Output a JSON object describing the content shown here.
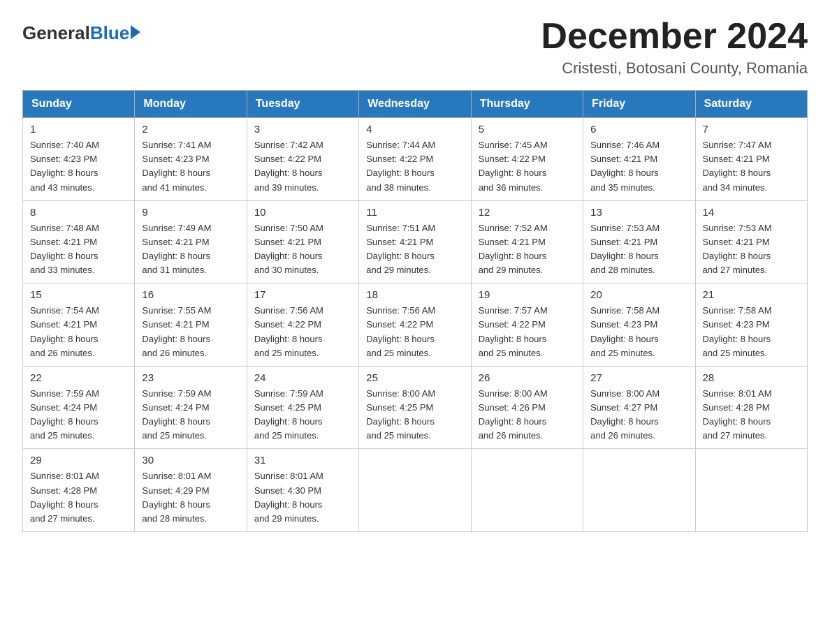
{
  "logo": {
    "general": "General",
    "blue": "Blue"
  },
  "title": "December 2024",
  "subtitle": "Cristesti, Botosani County, Romania",
  "weekdays": [
    "Sunday",
    "Monday",
    "Tuesday",
    "Wednesday",
    "Thursday",
    "Friday",
    "Saturday"
  ],
  "weeks": [
    [
      {
        "day": "1",
        "sunrise": "7:40 AM",
        "sunset": "4:23 PM",
        "daylight": "8 hours and 43 minutes."
      },
      {
        "day": "2",
        "sunrise": "7:41 AM",
        "sunset": "4:23 PM",
        "daylight": "8 hours and 41 minutes."
      },
      {
        "day": "3",
        "sunrise": "7:42 AM",
        "sunset": "4:22 PM",
        "daylight": "8 hours and 39 minutes."
      },
      {
        "day": "4",
        "sunrise": "7:44 AM",
        "sunset": "4:22 PM",
        "daylight": "8 hours and 38 minutes."
      },
      {
        "day": "5",
        "sunrise": "7:45 AM",
        "sunset": "4:22 PM",
        "daylight": "8 hours and 36 minutes."
      },
      {
        "day": "6",
        "sunrise": "7:46 AM",
        "sunset": "4:21 PM",
        "daylight": "8 hours and 35 minutes."
      },
      {
        "day": "7",
        "sunrise": "7:47 AM",
        "sunset": "4:21 PM",
        "daylight": "8 hours and 34 minutes."
      }
    ],
    [
      {
        "day": "8",
        "sunrise": "7:48 AM",
        "sunset": "4:21 PM",
        "daylight": "8 hours and 33 minutes."
      },
      {
        "day": "9",
        "sunrise": "7:49 AM",
        "sunset": "4:21 PM",
        "daylight": "8 hours and 31 minutes."
      },
      {
        "day": "10",
        "sunrise": "7:50 AM",
        "sunset": "4:21 PM",
        "daylight": "8 hours and 30 minutes."
      },
      {
        "day": "11",
        "sunrise": "7:51 AM",
        "sunset": "4:21 PM",
        "daylight": "8 hours and 29 minutes."
      },
      {
        "day": "12",
        "sunrise": "7:52 AM",
        "sunset": "4:21 PM",
        "daylight": "8 hours and 29 minutes."
      },
      {
        "day": "13",
        "sunrise": "7:53 AM",
        "sunset": "4:21 PM",
        "daylight": "8 hours and 28 minutes."
      },
      {
        "day": "14",
        "sunrise": "7:53 AM",
        "sunset": "4:21 PM",
        "daylight": "8 hours and 27 minutes."
      }
    ],
    [
      {
        "day": "15",
        "sunrise": "7:54 AM",
        "sunset": "4:21 PM",
        "daylight": "8 hours and 26 minutes."
      },
      {
        "day": "16",
        "sunrise": "7:55 AM",
        "sunset": "4:21 PM",
        "daylight": "8 hours and 26 minutes."
      },
      {
        "day": "17",
        "sunrise": "7:56 AM",
        "sunset": "4:22 PM",
        "daylight": "8 hours and 25 minutes."
      },
      {
        "day": "18",
        "sunrise": "7:56 AM",
        "sunset": "4:22 PM",
        "daylight": "8 hours and 25 minutes."
      },
      {
        "day": "19",
        "sunrise": "7:57 AM",
        "sunset": "4:22 PM",
        "daylight": "8 hours and 25 minutes."
      },
      {
        "day": "20",
        "sunrise": "7:58 AM",
        "sunset": "4:23 PM",
        "daylight": "8 hours and 25 minutes."
      },
      {
        "day": "21",
        "sunrise": "7:58 AM",
        "sunset": "4:23 PM",
        "daylight": "8 hours and 25 minutes."
      }
    ],
    [
      {
        "day": "22",
        "sunrise": "7:59 AM",
        "sunset": "4:24 PM",
        "daylight": "8 hours and 25 minutes."
      },
      {
        "day": "23",
        "sunrise": "7:59 AM",
        "sunset": "4:24 PM",
        "daylight": "8 hours and 25 minutes."
      },
      {
        "day": "24",
        "sunrise": "7:59 AM",
        "sunset": "4:25 PM",
        "daylight": "8 hours and 25 minutes."
      },
      {
        "day": "25",
        "sunrise": "8:00 AM",
        "sunset": "4:25 PM",
        "daylight": "8 hours and 25 minutes."
      },
      {
        "day": "26",
        "sunrise": "8:00 AM",
        "sunset": "4:26 PM",
        "daylight": "8 hours and 26 minutes."
      },
      {
        "day": "27",
        "sunrise": "8:00 AM",
        "sunset": "4:27 PM",
        "daylight": "8 hours and 26 minutes."
      },
      {
        "day": "28",
        "sunrise": "8:01 AM",
        "sunset": "4:28 PM",
        "daylight": "8 hours and 27 minutes."
      }
    ],
    [
      {
        "day": "29",
        "sunrise": "8:01 AM",
        "sunset": "4:28 PM",
        "daylight": "8 hours and 27 minutes."
      },
      {
        "day": "30",
        "sunrise": "8:01 AM",
        "sunset": "4:29 PM",
        "daylight": "8 hours and 28 minutes."
      },
      {
        "day": "31",
        "sunrise": "8:01 AM",
        "sunset": "4:30 PM",
        "daylight": "8 hours and 29 minutes."
      },
      null,
      null,
      null,
      null
    ]
  ],
  "labels": {
    "sunrise": "Sunrise:",
    "sunset": "Sunset:",
    "daylight": "Daylight:"
  }
}
